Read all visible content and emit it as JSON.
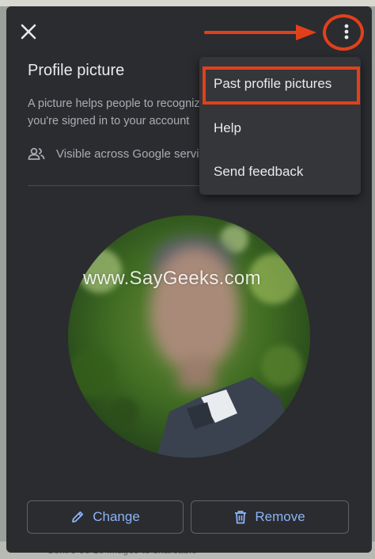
{
  "dialog": {
    "title": "Profile picture",
    "description": "A picture helps people to recognize you and lets you know when you're signed in to your account",
    "visibility": "Visible across Google services"
  },
  "watermark": "www.SayGeeks.com",
  "menu": {
    "items": [
      "Past profile pictures",
      "Help",
      "Send feedback"
    ]
  },
  "actions": {
    "change_label": "Change",
    "remove_label": "Remove"
  },
  "background": {
    "footer_text": "Sent 5 90 10 images to shareable"
  },
  "icons": {
    "close": "close-icon",
    "more": "more-vert-icon",
    "people": "people-icon",
    "pencil": "pencil-icon",
    "trash": "trash-icon"
  },
  "colors": {
    "dialog_bg": "#2b2c2f",
    "menu_bg": "#35363a",
    "accent": "#8ab4f8",
    "annotation": "#e2401b"
  }
}
